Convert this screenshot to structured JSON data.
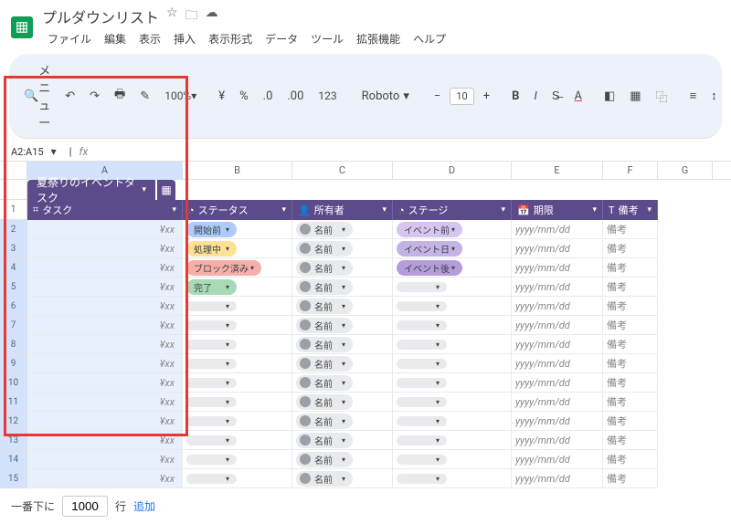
{
  "doc": {
    "title": "プルダウンリスト"
  },
  "menus": [
    "ファイル",
    "編集",
    "表示",
    "挿入",
    "表示形式",
    "データ",
    "ツール",
    "拡張機能",
    "ヘルプ"
  ],
  "toolbar": {
    "menu": "メニュー",
    "zoom": "100%",
    "currency": "¥",
    "pct": "%",
    "dec": "123",
    "font": "Roboto",
    "size": "10"
  },
  "cellref": {
    "name": "A2:A15"
  },
  "cols": [
    "A",
    "B",
    "C",
    "D",
    "E",
    "F",
    "G"
  ],
  "table": {
    "title": "夏祭りのイベントタスク",
    "headers": {
      "task": "タスク",
      "status": "ステータス",
      "owner": "所有者",
      "stage": "ステージ",
      "due": "期限",
      "notes": "備考"
    }
  },
  "placeholders": {
    "task": "¥xx",
    "owner": "名前",
    "due": "yyyy/mm/dd",
    "notes": "備考"
  },
  "statuses": [
    {
      "label": "開始前",
      "cls": "blue"
    },
    {
      "label": "処理中",
      "cls": "yellow"
    },
    {
      "label": "ブロック済み",
      "cls": "red"
    },
    {
      "label": "完了",
      "cls": "green"
    }
  ],
  "stages": [
    {
      "label": "イベント前",
      "cls": "lav1"
    },
    {
      "label": "イベント日",
      "cls": "lav2"
    },
    {
      "label": "イベント後",
      "cls": "lav3"
    }
  ],
  "rows": [
    2,
    3,
    4,
    5,
    6,
    7,
    8,
    9,
    10,
    11,
    12,
    13,
    14,
    15
  ],
  "footer": {
    "prefix": "一番下に",
    "value": "1000",
    "suffix": "行",
    "add": "追加"
  }
}
